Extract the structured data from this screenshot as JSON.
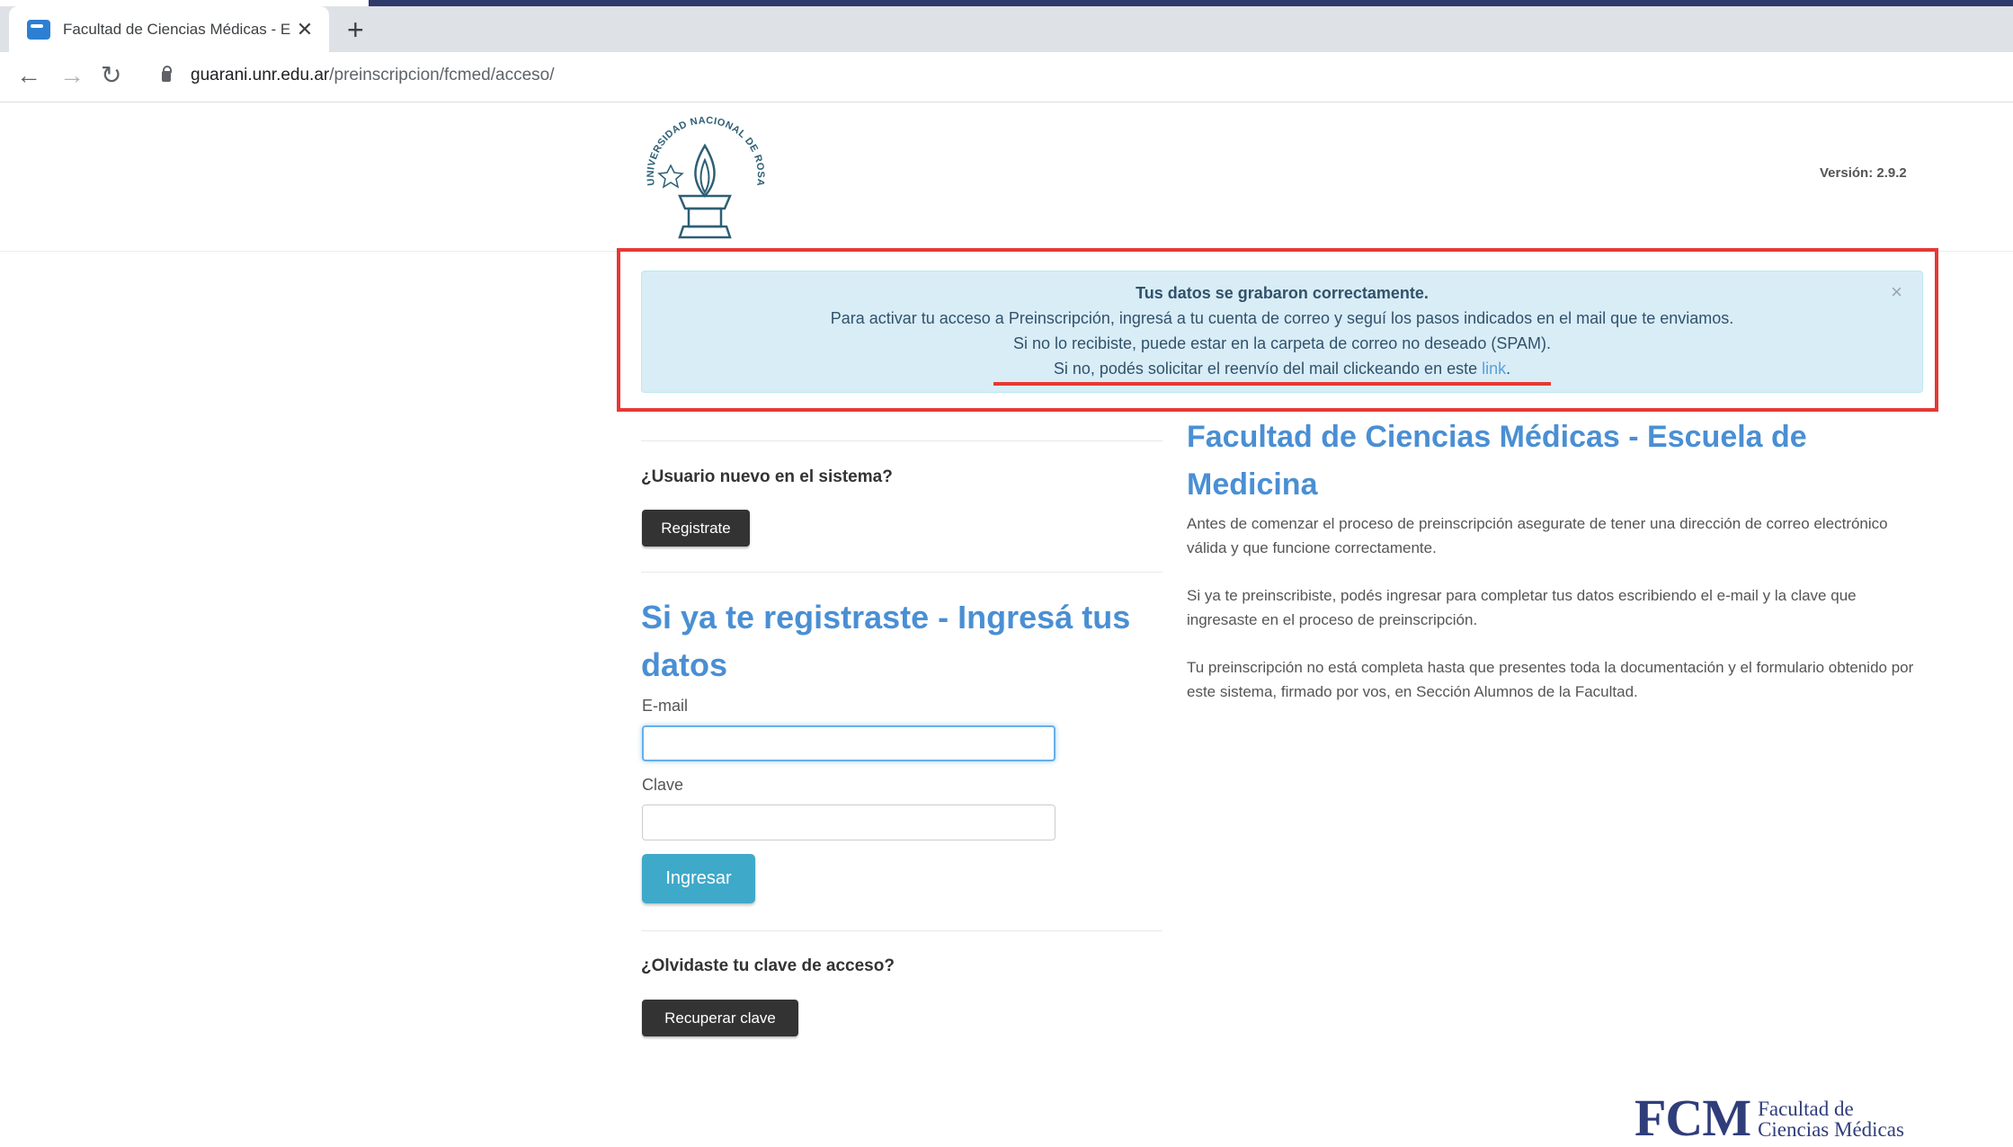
{
  "browser": {
    "tab_title": "Facultad de Ciencias Médicas - E",
    "tab_close": "✕",
    "new_tab": "+",
    "url_host": "guarani.unr.edu.ar",
    "url_path": "/preinscripcion/fcmed/acceso/"
  },
  "header": {
    "logo_text": "UNIVERSIDAD NACIONAL DE ROSARIO",
    "version": "Versión: 2.9.2"
  },
  "alert": {
    "line1": "Tus datos se grabaron correctamente.",
    "line2": "Para activar tu acceso a Preinscripción, ingresá a tu cuenta de correo y seguí los pasos indicados en el mail que te enviamos.",
    "line3": "Si no lo recibiste, puede estar en la carpeta de correo no deseado (SPAM).",
    "line4": "Si no, podés solicitar el reenvío del mail clickeando en este ",
    "link_text": "link",
    "line4_end": ".",
    "close": "×"
  },
  "register": {
    "question": "¿Usuario nuevo en el sistema?",
    "button": "Registrate"
  },
  "login": {
    "title": "Si ya te registraste - Ingresá tus datos",
    "email_label": "E-mail",
    "password_label": "Clave",
    "submit": "Ingresar"
  },
  "recover": {
    "question": "¿Olvidaste tu clave de acceso?",
    "button": "Recuperar clave"
  },
  "info": {
    "title": "Facultad de Ciencias Médicas - Escuela de Medicina",
    "p1": "Antes de comenzar el proceso de preinscripción asegurate de tener una dirección de correo electrónico válida y que funcione correctamente.",
    "p2": "Si ya te preinscribiste, podés ingresar para completar tus datos escribiendo el e-mail y la clave que ingresaste en el proceso de preinscripción.",
    "p3": "Tu preinscripción no está completa hasta que presentes toda la documentación y el formulario obtenido por este sistema, firmado por vos, en Sección Alumnos de la Facultad."
  },
  "footer": {
    "fcm": "FCM",
    "line1": "Facultad de",
    "line2": "Ciencias Médicas"
  },
  "colors": {
    "accent": "#2e3a6b",
    "alert_bg": "#d9edf7",
    "title_blue": "#4a8fd4",
    "primary_button": "#3fa9c9",
    "highlight_red": "#e53935"
  }
}
